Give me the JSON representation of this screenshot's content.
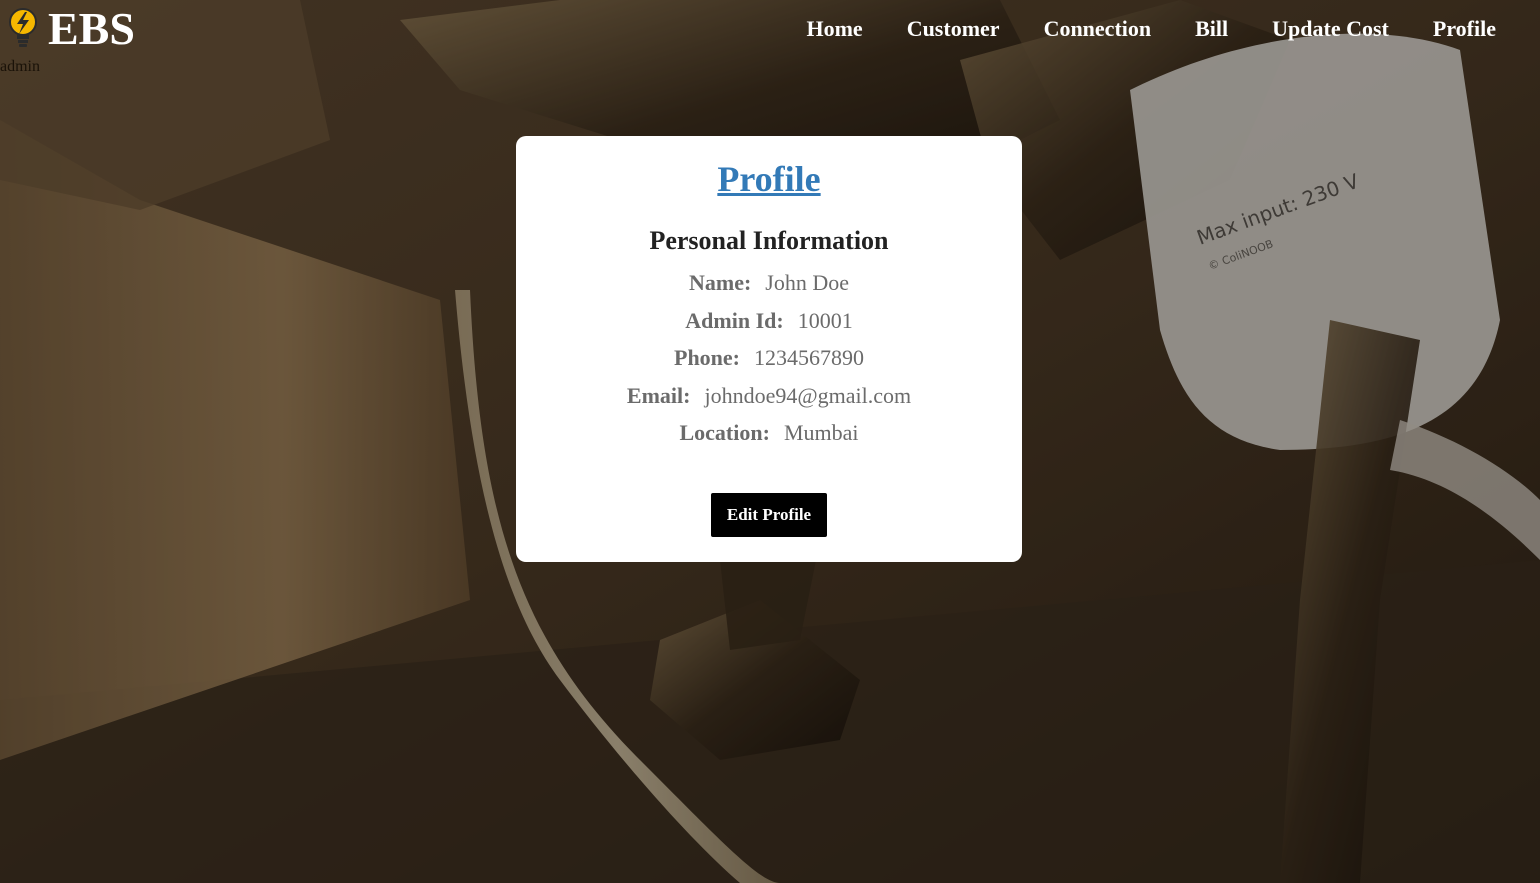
{
  "header": {
    "brand": "EBS",
    "user_role": "admin",
    "logo_icon": "lightbulb-icon"
  },
  "nav": {
    "items": [
      {
        "label": "Home"
      },
      {
        "label": "Customer"
      },
      {
        "label": "Connection"
      },
      {
        "label": "Bill"
      },
      {
        "label": "Update Cost"
      },
      {
        "label": "Profile"
      }
    ]
  },
  "profile": {
    "title": "Profile",
    "section_title": "Personal Information",
    "fields": [
      {
        "label": "Name:",
        "value": "John Doe"
      },
      {
        "label": "Admin Id:",
        "value": "10001"
      },
      {
        "label": "Phone:",
        "value": "1234567890"
      },
      {
        "label": "Email:",
        "value": "johndoe94@gmail.com"
      },
      {
        "label": "Location:",
        "value": "Mumbai"
      }
    ],
    "edit_button_label": "Edit Profile"
  },
  "colors": {
    "title_link": "#337ab7",
    "button_bg": "#000000",
    "card_bg": "#ffffff",
    "nav_text": "#ffffff"
  }
}
